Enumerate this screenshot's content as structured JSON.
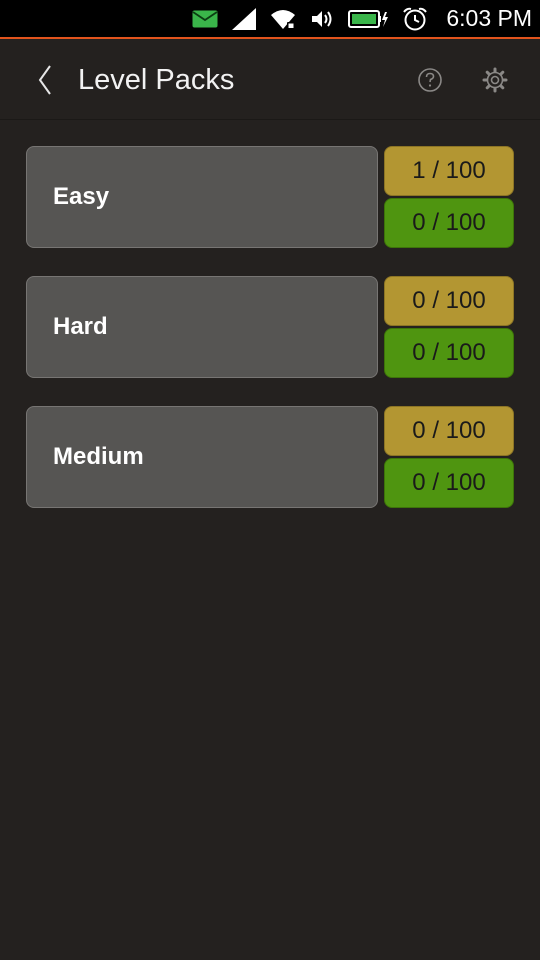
{
  "status_bar": {
    "time": "6:03 PM",
    "indicators": [
      "mail-icon",
      "signal-icon",
      "wifi-icon",
      "volume-icon",
      "battery-charging-icon",
      "alarm-icon"
    ],
    "accent_color": "#e2541d",
    "mail_color": "#3ab54a",
    "battery_color": "#3ab54a"
  },
  "header": {
    "title": "Level Packs",
    "back_icon": "chevron-left-icon",
    "actions": [
      "help-icon",
      "settings-icon"
    ]
  },
  "packs": [
    {
      "name": "Easy",
      "gold_progress": "1 / 100",
      "green_progress": "0 / 100"
    },
    {
      "name": "Hard",
      "gold_progress": "0 / 100",
      "green_progress": "0 / 100"
    },
    {
      "name": "Medium",
      "gold_progress": "0 / 100",
      "green_progress": "0 / 100"
    }
  ],
  "colors": {
    "background": "#24211f",
    "pack_button": "#565553",
    "gold": "#b39632",
    "green": "#4f9510"
  }
}
